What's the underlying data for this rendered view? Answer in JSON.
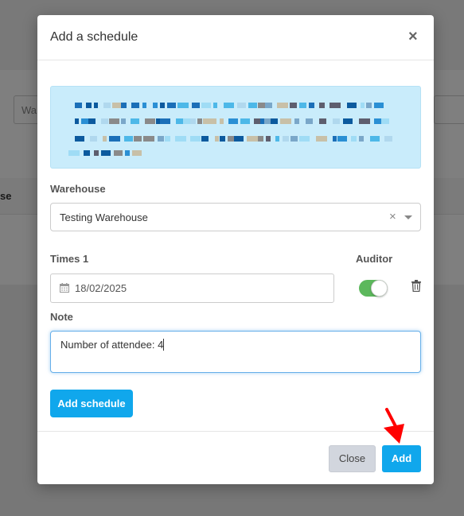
{
  "background": {
    "search_placeholder": "Wa",
    "column_fragment": "se"
  },
  "modal": {
    "title": "Add a schedule",
    "close_icon": "close-x-icon",
    "warehouse": {
      "label": "Warehouse",
      "value": "Testing Warehouse"
    },
    "times": {
      "label": "Times 1",
      "date_value": "18/02/2025"
    },
    "auditor": {
      "label": "Auditor",
      "enabled": true
    },
    "note": {
      "label": "Note",
      "value": "Number of attendee: 4"
    },
    "add_schedule_label": "Add schedule",
    "footer": {
      "close_label": "Close",
      "add_label": "Add"
    }
  },
  "colors": {
    "primary": "#10a7ec",
    "toggle_on": "#5cb85c",
    "info_bg": "#c9ecfb",
    "annotation_arrow": "#ff0000"
  },
  "icons": [
    "close-x-icon",
    "clear-icon",
    "chevron-down-icon",
    "calendar-icon",
    "trash-icon",
    "red-arrow-icon"
  ]
}
